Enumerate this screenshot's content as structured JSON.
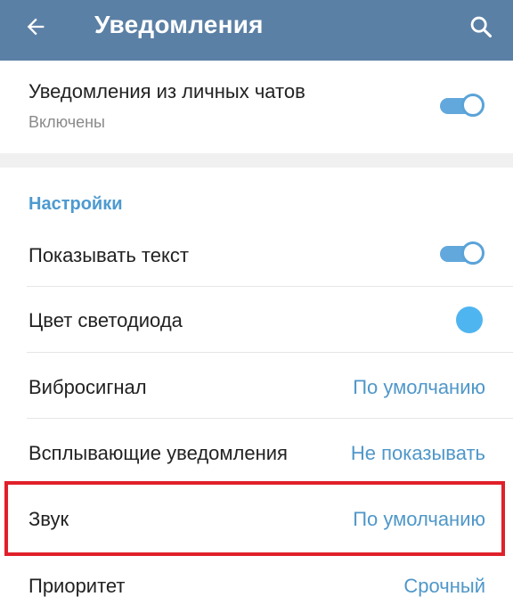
{
  "appbar": {
    "title": "Уведомления",
    "back_icon": "arrow-left-icon",
    "search_icon": "search-icon",
    "background_color": "#5b80a5"
  },
  "private_chats": {
    "title": "Уведомления из личных чатов",
    "status": "Включены",
    "enabled": true
  },
  "settings": {
    "header": "Настройки",
    "show_text": {
      "label": "Показывать текст",
      "enabled": true
    },
    "led_color": {
      "label": "Цвет светодиода",
      "color": "#4fb5f0"
    },
    "vibrate": {
      "label": "Вибросигнал",
      "value": "По умолчанию"
    },
    "popup": {
      "label": "Всплывающие уведомления",
      "value": "Не показывать"
    },
    "sound": {
      "label": "Звук",
      "value": "По умолчанию"
    },
    "priority": {
      "label": "Приоритет",
      "value": "Срочный"
    }
  },
  "colors": {
    "accent": "#4f97c9",
    "toggle_on": "#62a8dc",
    "highlight": "#e0202a"
  }
}
